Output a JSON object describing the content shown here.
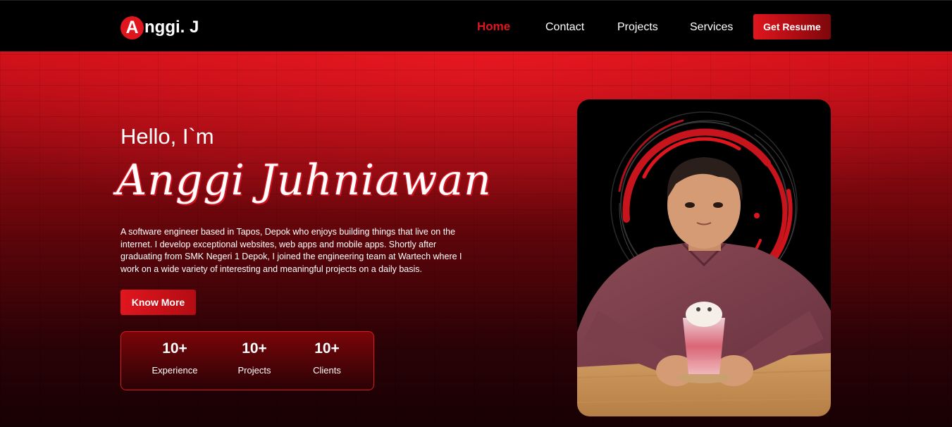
{
  "header": {
    "logo_initial": "A",
    "logo_rest": "nggi. J",
    "nav": [
      {
        "label": "Home",
        "active": true
      },
      {
        "label": "Contact",
        "active": false
      },
      {
        "label": "Projects",
        "active": false
      },
      {
        "label": "Services",
        "active": false
      }
    ],
    "resume_label": "Get Resume"
  },
  "hero": {
    "greeting": "Hello, I`m",
    "name": "Anggi Juhniawan",
    "bio": "A software engineer based in Tapos, Depok who enjoys building things that live on the internet. I develop exceptional websites, web apps and mobile apps. Shortly after graduating from SMK Negeri 1 Depok, I joined the engineering team at Wartech where I work on a wide variety of interesting and meaningful projects on a daily basis.",
    "cta_label": "Know More",
    "stats": [
      {
        "value": "10+",
        "label": "Experience"
      },
      {
        "value": "10+",
        "label": "Projects"
      },
      {
        "value": "10+",
        "label": "Clients"
      }
    ]
  },
  "colors": {
    "accent": "#e0161e",
    "nav_bg": "#000000",
    "hero_top": "#cc0f18",
    "hero_bottom": "#180104"
  }
}
